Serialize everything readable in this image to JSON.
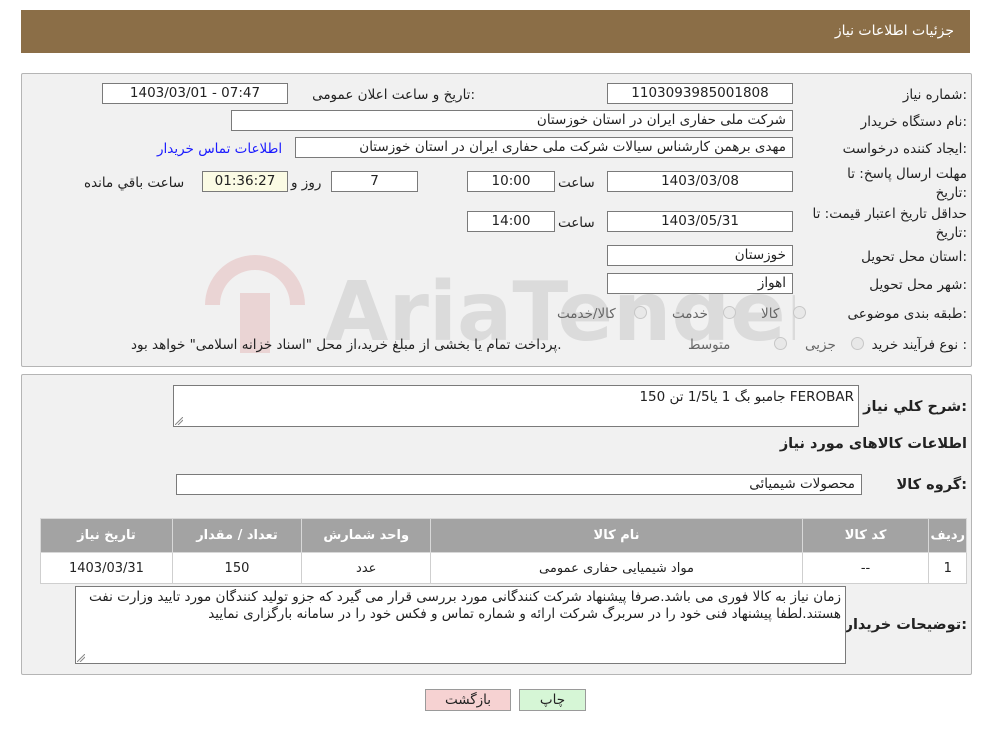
{
  "header": {
    "title": "جزئیات اطلاعات نیاز"
  },
  "labels": {
    "need_number": "شماره نیاز:",
    "announce_datetime": "تاریخ و ساعت اعلان عمومی:",
    "buyer_org": "نام دستگاه خریدار:",
    "requester": "ایجاد کننده درخواست:",
    "response_deadline": "مهلت ارسال پاسخ: تا تاریخ:",
    "time": "ساعت",
    "days_and": "روز و",
    "time_remaining": "ساعت باقي مانده",
    "price_validity": "حداقل تاریخ اعتبار قیمت: تا تاریخ:",
    "delivery_province": "استان محل تحویل:",
    "delivery_city": "شهر محل تحویل:",
    "category": "طبقه بندی موضوعی:",
    "purchase_type": "نوع فرآیند خرید :",
    "need_description": "شرح کلي نياز:",
    "goods_info": "اطلاعات کالاهای مورد نیاز",
    "goods_group": "گروه کالا:",
    "buyer_notes": "توضیحات خریدار:"
  },
  "fields": {
    "need_number": "1103093985001808",
    "announce_datetime": "1403/03/01 - 07:47",
    "buyer_org": "شرکت ملی حفاری ایران در استان خوزستان",
    "requester": "مهدی برهمن کارشناس سیالات شرکت ملی حفاری ایران در استان خوزستان",
    "contact_link": "اطلاعات تماس خریدار",
    "response_date": "1403/03/08",
    "response_time": "10:00",
    "days": "7",
    "remaining": "01:36:27",
    "validity_date": "1403/05/31",
    "validity_time": "14:00",
    "province": "خوزستان",
    "city": "اهواز",
    "need_description": "150 جامبو بگ 1 یا1/5 تن FEROBAR",
    "goods_group": "محصولات شیمیائی",
    "buyer_notes": "زمان نیاز به کالا فوری می باشد.صرفا پیشنهاد شرکت کنندگانی مورد بررسی قرار می گیرد که جزو تولید کنندگان مورد تایید وزارت نفت هستند.لطفا پیشنهاد فنی خود را در سربرگ شرکت ارائه و شماره تماس و فکس خود را در سامانه بارگزاری نمایید"
  },
  "category_options": [
    "کالا",
    "خدمت",
    "کالا/خدمت"
  ],
  "purchase_options": [
    "جزیی",
    "متوسط"
  ],
  "purchase_note": "پرداخت تمام یا بخشی از مبلغ خرید،از محل \"اسناد خزانه اسلامی\" خواهد بود.",
  "table": {
    "headers": [
      "ردیف",
      "کد کالا",
      "نام کالا",
      "واحد شمارش",
      "تعداد / مقدار",
      "تاریخ نیاز"
    ],
    "rows": [
      [
        "1",
        "--",
        "مواد شیمیایی حفاری عمومی",
        "عدد",
        "150",
        "1403/03/31"
      ]
    ]
  },
  "buttons": {
    "print": "چاپ",
    "back": "بازگشت"
  },
  "watermark": {
    "text": "AriaTender.neT"
  },
  "colors": {
    "header_bg": "#8b6e47",
    "link": "#1a1aff",
    "back_btn_bg": "#f6d2d2",
    "print_btn_bg": "#d6f6d6"
  }
}
